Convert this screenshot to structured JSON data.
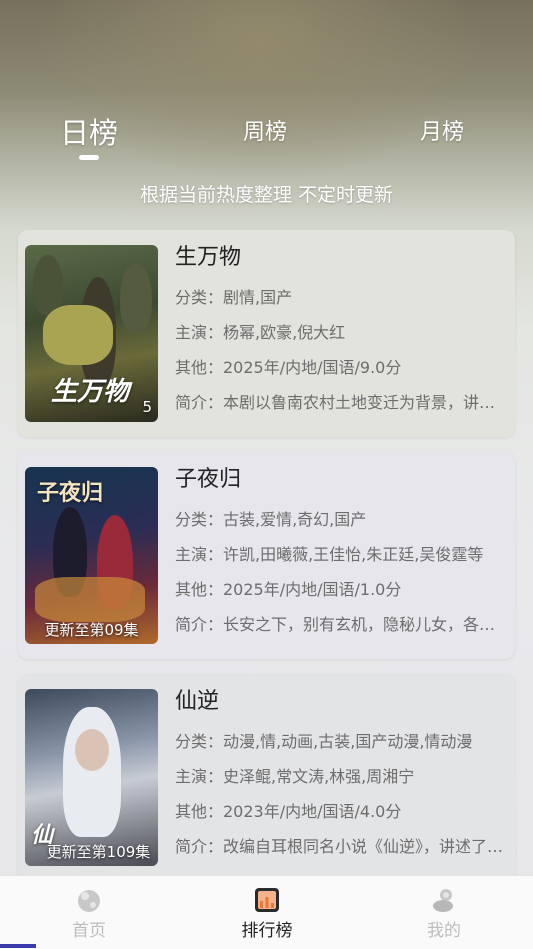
{
  "tabs": [
    {
      "label": "日榜",
      "active": true
    },
    {
      "label": "周榜",
      "active": false
    },
    {
      "label": "月榜",
      "active": false
    }
  ],
  "subtitle": "根据当前热度整理 不定时更新",
  "items": [
    {
      "title": "生万物",
      "poster_text": "生万物",
      "poster_badge": "5",
      "genre": "分类：剧情,国产",
      "cast": "主演：杨幂,欧豪,倪大红",
      "other": "其他：2025年/内地/国语/9.0分",
      "intro": "简介：本剧以鲁南农村土地变迁为背景，讲述了一个家族的故事"
    },
    {
      "title": "子夜归",
      "poster_text": "子夜归",
      "poster_badge": "更新至第09集",
      "genre": "分类：古装,爱情,奇幻,国产",
      "cast": "主演：许凯,田曦薇,王佳怡,朱正廷,吴俊霆等",
      "other": "其他：2025年/内地/国语/1.0分",
      "intro": "简介：长安之下，别有玄机，隐秘儿女，各显神通"
    },
    {
      "title": "仙逆",
      "poster_text": "仙",
      "poster_badge": "更新至第109集",
      "genre": "分类：动漫,情,动画,古装,国产动漫,情动漫",
      "cast": "主演：史泽鲲,常文涛,林强,周湘宁",
      "other": "其他：2023年/内地/国语/4.0分",
      "intro": "简介：改编自耳根同名小说《仙逆》，讲述了王林的故事"
    }
  ],
  "nav": [
    {
      "label": "首页",
      "icon": "home-icon",
      "active": false
    },
    {
      "label": "排行榜",
      "icon": "ranking-icon",
      "active": true
    },
    {
      "label": "我的",
      "icon": "profile-icon",
      "active": false
    }
  ],
  "colors": {
    "active_label": "#222222",
    "inactive_label": "#bdbdbd",
    "accent": "#e8773a"
  }
}
